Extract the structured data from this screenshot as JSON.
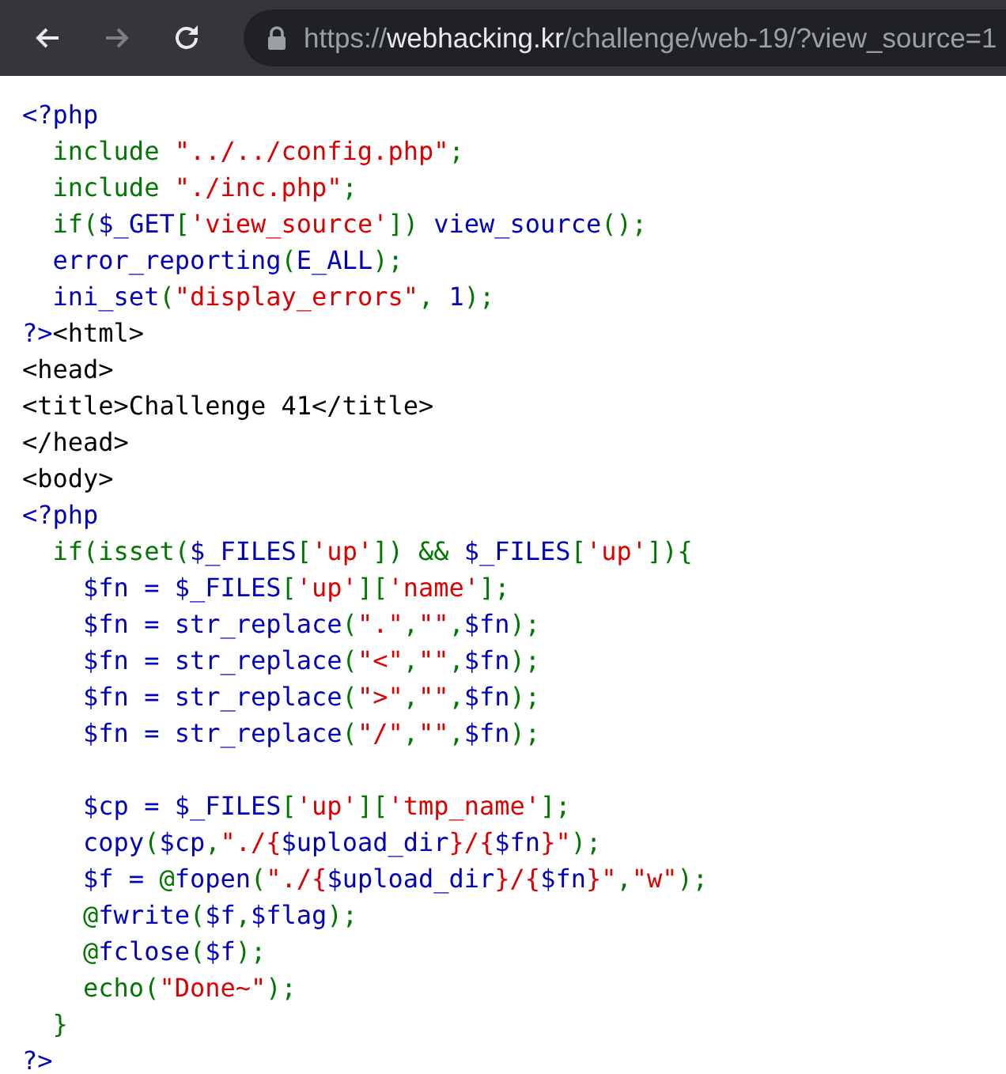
{
  "toolbar": {
    "back_button": {
      "disabled": false
    },
    "forward_button": {
      "disabled": true
    },
    "address": {
      "secure": true,
      "scheme": "https://",
      "domain": "webhacking.kr",
      "path": "/challenge/web-19/?view_source=1"
    }
  },
  "source_lines": [
    {
      "kind": "code",
      "tokens": [
        {
          "kind": "default",
          "text": "<?php"
        }
      ]
    },
    {
      "kind": "code",
      "tokens": [
        {
          "kind": "keyword",
          "text": "  include "
        },
        {
          "kind": "string",
          "text": "\"../../config.php\""
        },
        {
          "kind": "keyword",
          "text": ";"
        }
      ]
    },
    {
      "kind": "code",
      "tokens": [
        {
          "kind": "keyword",
          "text": "  include "
        },
        {
          "kind": "string",
          "text": "\"./inc.php\""
        },
        {
          "kind": "keyword",
          "text": ";"
        }
      ]
    },
    {
      "kind": "code",
      "tokens": [
        {
          "kind": "keyword",
          "text": "  if("
        },
        {
          "kind": "default",
          "text": "$_GET"
        },
        {
          "kind": "keyword",
          "text": "["
        },
        {
          "kind": "string",
          "text": "'view_source'"
        },
        {
          "kind": "keyword",
          "text": "]) "
        },
        {
          "kind": "default",
          "text": "view_source"
        },
        {
          "kind": "keyword",
          "text": "();"
        }
      ]
    },
    {
      "kind": "code",
      "tokens": [
        {
          "kind": "default",
          "text": "  error_reporting"
        },
        {
          "kind": "keyword",
          "text": "("
        },
        {
          "kind": "default",
          "text": "E_ALL"
        },
        {
          "kind": "keyword",
          "text": ");"
        }
      ]
    },
    {
      "kind": "code",
      "tokens": [
        {
          "kind": "default",
          "text": "  ini_set"
        },
        {
          "kind": "keyword",
          "text": "("
        },
        {
          "kind": "string",
          "text": "\"display_errors\""
        },
        {
          "kind": "keyword",
          "text": ", "
        },
        {
          "kind": "default",
          "text": "1"
        },
        {
          "kind": "keyword",
          "text": ");"
        }
      ]
    },
    {
      "kind": "code",
      "tokens": [
        {
          "kind": "default",
          "text": "?>"
        },
        {
          "kind": "html",
          "text": "<html>"
        }
      ]
    },
    {
      "kind": "code",
      "tokens": [
        {
          "kind": "html",
          "text": "<head>"
        }
      ]
    },
    {
      "kind": "code",
      "tokens": [
        {
          "kind": "html",
          "text": "<title>Challenge 41</title>"
        }
      ]
    },
    {
      "kind": "code",
      "tokens": [
        {
          "kind": "html",
          "text": "</head>"
        }
      ]
    },
    {
      "kind": "code",
      "tokens": [
        {
          "kind": "html",
          "text": "<body>"
        }
      ]
    },
    {
      "kind": "code",
      "tokens": [
        {
          "kind": "default",
          "text": "<?php"
        }
      ]
    },
    {
      "kind": "code",
      "tokens": [
        {
          "kind": "keyword",
          "text": "  if(isset("
        },
        {
          "kind": "default",
          "text": "$_FILES"
        },
        {
          "kind": "keyword",
          "text": "["
        },
        {
          "kind": "string",
          "text": "'up'"
        },
        {
          "kind": "keyword",
          "text": "]) && "
        },
        {
          "kind": "default",
          "text": "$_FILES"
        },
        {
          "kind": "keyword",
          "text": "["
        },
        {
          "kind": "string",
          "text": "'up'"
        },
        {
          "kind": "keyword",
          "text": "]){"
        }
      ]
    },
    {
      "kind": "code",
      "tokens": [
        {
          "kind": "default",
          "text": "    $fn = $_FILES"
        },
        {
          "kind": "keyword",
          "text": "["
        },
        {
          "kind": "string",
          "text": "'up'"
        },
        {
          "kind": "keyword",
          "text": "]["
        },
        {
          "kind": "string",
          "text": "'name'"
        },
        {
          "kind": "keyword",
          "text": "];"
        }
      ]
    },
    {
      "kind": "code",
      "tokens": [
        {
          "kind": "default",
          "text": "    $fn = str_replace"
        },
        {
          "kind": "keyword",
          "text": "("
        },
        {
          "kind": "string",
          "text": "\".\""
        },
        {
          "kind": "keyword",
          "text": ","
        },
        {
          "kind": "string",
          "text": "\"\""
        },
        {
          "kind": "keyword",
          "text": ","
        },
        {
          "kind": "default",
          "text": "$fn"
        },
        {
          "kind": "keyword",
          "text": ");"
        }
      ]
    },
    {
      "kind": "code",
      "tokens": [
        {
          "kind": "default",
          "text": "    $fn = str_replace"
        },
        {
          "kind": "keyword",
          "text": "("
        },
        {
          "kind": "string",
          "text": "\"<\""
        },
        {
          "kind": "keyword",
          "text": ","
        },
        {
          "kind": "string",
          "text": "\"\""
        },
        {
          "kind": "keyword",
          "text": ","
        },
        {
          "kind": "default",
          "text": "$fn"
        },
        {
          "kind": "keyword",
          "text": ");"
        }
      ]
    },
    {
      "kind": "code",
      "tokens": [
        {
          "kind": "default",
          "text": "    $fn = str_replace"
        },
        {
          "kind": "keyword",
          "text": "("
        },
        {
          "kind": "string",
          "text": "\">\""
        },
        {
          "kind": "keyword",
          "text": ","
        },
        {
          "kind": "string",
          "text": "\"\""
        },
        {
          "kind": "keyword",
          "text": ","
        },
        {
          "kind": "default",
          "text": "$fn"
        },
        {
          "kind": "keyword",
          "text": ");"
        }
      ]
    },
    {
      "kind": "code",
      "tokens": [
        {
          "kind": "default",
          "text": "    $fn = str_replace"
        },
        {
          "kind": "keyword",
          "text": "("
        },
        {
          "kind": "string",
          "text": "\"/\""
        },
        {
          "kind": "keyword",
          "text": ","
        },
        {
          "kind": "string",
          "text": "\"\""
        },
        {
          "kind": "keyword",
          "text": ","
        },
        {
          "kind": "default",
          "text": "$fn"
        },
        {
          "kind": "keyword",
          "text": ");"
        }
      ]
    },
    {
      "kind": "blank"
    },
    {
      "kind": "code",
      "tokens": [
        {
          "kind": "default",
          "text": "    $cp = $_FILES"
        },
        {
          "kind": "keyword",
          "text": "["
        },
        {
          "kind": "string",
          "text": "'up'"
        },
        {
          "kind": "keyword",
          "text": "]["
        },
        {
          "kind": "string",
          "text": "'tmp_name'"
        },
        {
          "kind": "keyword",
          "text": "];"
        }
      ]
    },
    {
      "kind": "code",
      "tokens": [
        {
          "kind": "default",
          "text": "    copy"
        },
        {
          "kind": "keyword",
          "text": "("
        },
        {
          "kind": "default",
          "text": "$cp"
        },
        {
          "kind": "keyword",
          "text": ","
        },
        {
          "kind": "string",
          "text": "\"./{"
        },
        {
          "kind": "default",
          "text": "$upload_dir"
        },
        {
          "kind": "string",
          "text": "}/{"
        },
        {
          "kind": "default",
          "text": "$fn"
        },
        {
          "kind": "string",
          "text": "}\""
        },
        {
          "kind": "keyword",
          "text": ");"
        }
      ]
    },
    {
      "kind": "code",
      "tokens": [
        {
          "kind": "default",
          "text": "    $f = "
        },
        {
          "kind": "keyword",
          "text": "@"
        },
        {
          "kind": "default",
          "text": "fopen"
        },
        {
          "kind": "keyword",
          "text": "("
        },
        {
          "kind": "string",
          "text": "\"./{"
        },
        {
          "kind": "default",
          "text": "$upload_dir"
        },
        {
          "kind": "string",
          "text": "}/{"
        },
        {
          "kind": "default",
          "text": "$fn"
        },
        {
          "kind": "string",
          "text": "}\""
        },
        {
          "kind": "keyword",
          "text": ","
        },
        {
          "kind": "string",
          "text": "\"w\""
        },
        {
          "kind": "keyword",
          "text": ");"
        }
      ]
    },
    {
      "kind": "code",
      "tokens": [
        {
          "kind": "keyword",
          "text": "    @"
        },
        {
          "kind": "default",
          "text": "fwrite"
        },
        {
          "kind": "keyword",
          "text": "("
        },
        {
          "kind": "default",
          "text": "$f"
        },
        {
          "kind": "keyword",
          "text": ","
        },
        {
          "kind": "default",
          "text": "$flag"
        },
        {
          "kind": "keyword",
          "text": ");"
        }
      ]
    },
    {
      "kind": "code",
      "tokens": [
        {
          "kind": "keyword",
          "text": "    @"
        },
        {
          "kind": "default",
          "text": "fclose"
        },
        {
          "kind": "keyword",
          "text": "("
        },
        {
          "kind": "default",
          "text": "$f"
        },
        {
          "kind": "keyword",
          "text": ");"
        }
      ]
    },
    {
      "kind": "code",
      "tokens": [
        {
          "kind": "keyword",
          "text": "    echo("
        },
        {
          "kind": "string",
          "text": "\"Done~\""
        },
        {
          "kind": "keyword",
          "text": ");"
        }
      ]
    },
    {
      "kind": "code",
      "tokens": [
        {
          "kind": "keyword",
          "text": "  }"
        }
      ]
    },
    {
      "kind": "code",
      "tokens": [
        {
          "kind": "default",
          "text": "?>"
        }
      ]
    }
  ]
}
